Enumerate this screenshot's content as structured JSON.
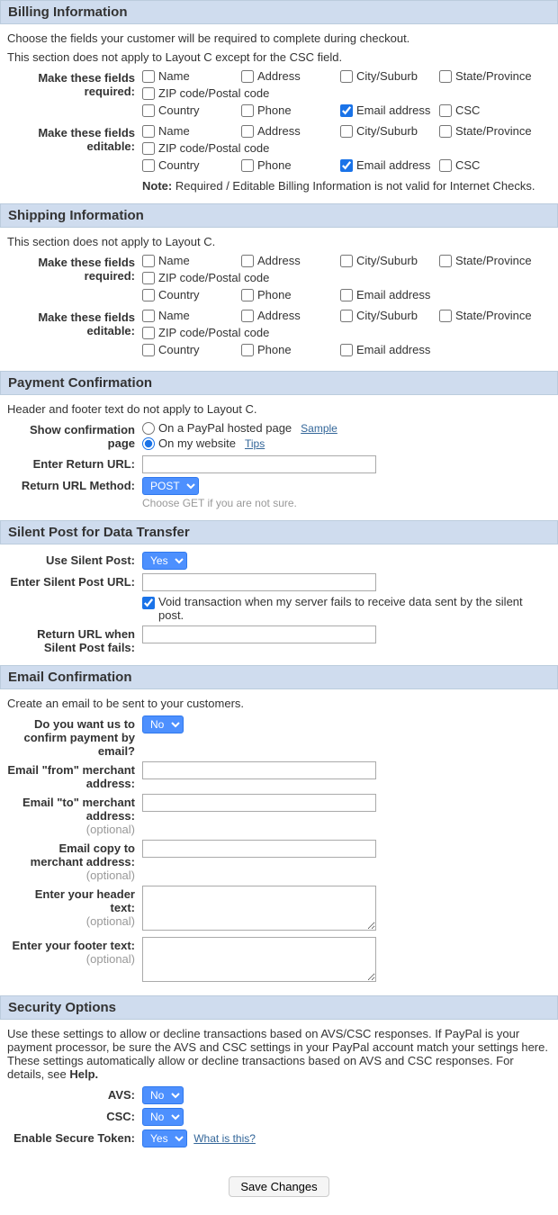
{
  "billing": {
    "title": "Billing Information",
    "desc1": "Choose the fields your customer will be required to complete during checkout.",
    "desc2": "This section does not apply to Layout C except for the CSC field.",
    "required_label": "Make these fields required:",
    "editable_label": "Make these fields editable:",
    "fields": {
      "name": "Name",
      "address": "Address",
      "city": "City/Suburb",
      "state": "State/Province",
      "zip": "ZIP code/Postal code",
      "country": "Country",
      "phone": "Phone",
      "email": "Email address",
      "csc": "CSC"
    },
    "note_label": "Note:",
    "note_text": "Required / Editable Billing Information is not valid for Internet Checks."
  },
  "shipping": {
    "title": "Shipping Information",
    "desc": "This section does not apply to Layout C.",
    "required_label": "Make these fields required:",
    "editable_label": "Make these fields editable:"
  },
  "payment": {
    "title": "Payment Confirmation",
    "desc": "Header and footer text do not apply to Layout C.",
    "show_label": "Show confirmation page",
    "opt_paypal": "On a PayPal hosted page",
    "opt_mysite": "On my website",
    "sample": "Sample",
    "tips": "Tips",
    "return_url_label": "Enter Return URL:",
    "return_method_label": "Return URL Method:",
    "method_value": "POST",
    "method_hint": "Choose GET if you are not sure."
  },
  "silent": {
    "title": "Silent Post for Data Transfer",
    "use_label": "Use Silent Post:",
    "use_value": "Yes",
    "url_label": "Enter Silent Post URL:",
    "void_label": "Void transaction when my server fails to receive data sent by the silent post.",
    "fail_label1": "Return URL when",
    "fail_label2": "Silent Post fails:"
  },
  "email": {
    "title": "Email Confirmation",
    "desc": "Create an email to be sent to your customers.",
    "confirm_label1": "Do you want us to",
    "confirm_label2": "confirm payment by",
    "confirm_label3": "email?",
    "confirm_value": "No",
    "from_label1": "Email \"from\" merchant",
    "from_label2": "address:",
    "to_label1": "Email \"to\" merchant",
    "to_label2": "address:",
    "copy_label1": "Email copy to",
    "copy_label2": "merchant address:",
    "header_label": "Enter your header text:",
    "footer_label": "Enter your footer text:",
    "optional": "(optional)"
  },
  "security": {
    "title": "Security Options",
    "desc": "Use these settings to allow or decline transactions based on AVS/CSC responses. If PayPal is your payment processor, be sure the AVS and CSC settings in your PayPal account match your settings here. These settings automatically allow or decline transactions based on AVS and CSC responses. For details, see ",
    "help": "Help.",
    "avs_label": "AVS:",
    "avs_value": "No",
    "csc_label": "CSC:",
    "csc_value": "No",
    "token_label": "Enable Secure Token:",
    "token_value": "Yes",
    "what": "What is this?"
  },
  "save": "Save Changes"
}
